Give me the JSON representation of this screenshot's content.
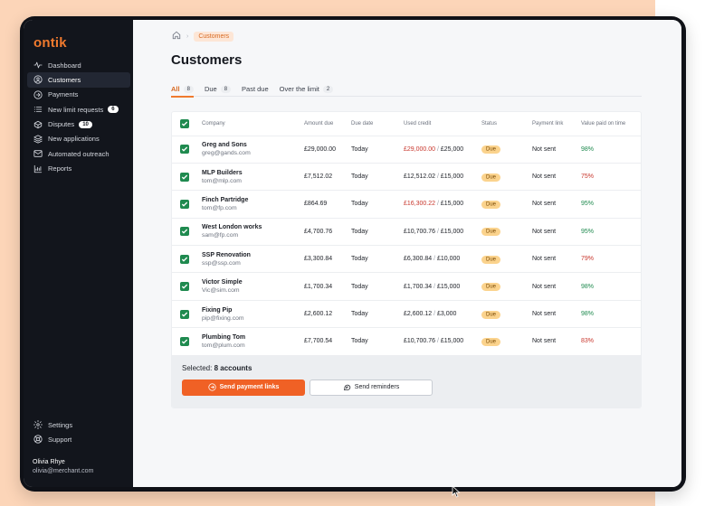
{
  "app": {
    "logo": "ontik"
  },
  "sidebar": {
    "items": [
      {
        "label": "Dashboard",
        "icon": "pulse-icon"
      },
      {
        "label": "Customers",
        "icon": "user-icon",
        "active": true
      },
      {
        "label": "Payments",
        "icon": "arrow-circle-icon"
      },
      {
        "label": "New limit requests",
        "icon": "list-icon",
        "badge": "6"
      },
      {
        "label": "Disputes",
        "icon": "box-icon",
        "badge": "10"
      },
      {
        "label": "New applications",
        "icon": "layers-icon"
      },
      {
        "label": "Automated outreach",
        "icon": "mail-icon"
      },
      {
        "label": "Reports",
        "icon": "chart-icon"
      }
    ],
    "bottom": [
      {
        "label": "Settings",
        "icon": "gear-icon"
      },
      {
        "label": "Support",
        "icon": "life-buoy-icon"
      }
    ],
    "user": {
      "name": "Olivia Rhye",
      "email": "olivia@merchant.com"
    }
  },
  "breadcrumb": {
    "current": "Customers"
  },
  "page": {
    "title": "Customers"
  },
  "tabs": [
    {
      "label": "All",
      "count": "8",
      "active": true
    },
    {
      "label": "Due",
      "count": "8"
    },
    {
      "label": "Past due",
      "count": ""
    },
    {
      "label": "Over the limit",
      "count": "2"
    }
  ],
  "table": {
    "headers": [
      "Company",
      "Amount due",
      "Due date",
      "Used credit",
      "Status",
      "Payment link",
      "Value paid on time"
    ],
    "rows": [
      {
        "company": "Greg and Sons",
        "email": "greg@gands.com",
        "amount": "£29,000.00",
        "due_date": "Today",
        "used": "£29,000.00",
        "limit": "£25,000",
        "over_limit": true,
        "status": "Due",
        "payment_link": "Not sent",
        "value_paid": "98%",
        "good": true
      },
      {
        "company": "MLP Builders",
        "email": "tom@mlp.com",
        "amount": "£7,512.02",
        "due_date": "Today",
        "used": "£12,512.02",
        "limit": "£15,000",
        "over_limit": false,
        "status": "Due",
        "payment_link": "Not sent",
        "value_paid": "75%",
        "good": false
      },
      {
        "company": "Finch Partridge",
        "email": "tom@fp.com",
        "amount": "£864.69",
        "due_date": "Today",
        "used": "£16,300.22",
        "limit": "£15,000",
        "over_limit": true,
        "status": "Due",
        "payment_link": "Not sent",
        "value_paid": "95%",
        "good": true
      },
      {
        "company": "West London works",
        "email": "sam@fp.com",
        "amount": "£4,700.76",
        "due_date": "Today",
        "used": "£10,700.76",
        "limit": "£15,000",
        "over_limit": false,
        "status": "Due",
        "payment_link": "Not sent",
        "value_paid": "95%",
        "good": true
      },
      {
        "company": "SSP Renovation",
        "email": "ssp@ssp.com",
        "amount": "£3,300.84",
        "due_date": "Today",
        "used": "£6,300.84",
        "limit": "£10,000",
        "over_limit": false,
        "status": "Due",
        "payment_link": "Not sent",
        "value_paid": "79%",
        "good": false
      },
      {
        "company": "Victor Simple",
        "email": "Vic@sim.com",
        "amount": "£1,700.34",
        "due_date": "Today",
        "used": "£1,700.34",
        "limit": "£15,000",
        "over_limit": false,
        "status": "Due",
        "payment_link": "Not sent",
        "value_paid": "98%",
        "good": true
      },
      {
        "company": "Fixing Pip",
        "email": "pip@fixing.com",
        "amount": "£2,600.12",
        "due_date": "Today",
        "used": "£2,600.12",
        "limit": "£3,000",
        "over_limit": false,
        "status": "Due",
        "payment_link": "Not sent",
        "value_paid": "98%",
        "good": true
      },
      {
        "company": "Plumbing Tom",
        "email": "tom@plum.com",
        "amount": "£7,700.54",
        "due_date": "Today",
        "used": "£10,700.76",
        "limit": "£15,000",
        "over_limit": false,
        "status": "Due",
        "payment_link": "Not sent",
        "value_paid": "83%",
        "good": false
      }
    ]
  },
  "selection": {
    "label": "Selected:",
    "value": "8 accounts"
  },
  "actions": {
    "send_links": "Send payment links",
    "send_reminders": "Send reminders"
  },
  "colors": {
    "accent": "#f06125",
    "sidebar": "#12151c",
    "good": "#1f8a4f",
    "bad": "#c8372d",
    "due_badge": "#fbd38d"
  }
}
